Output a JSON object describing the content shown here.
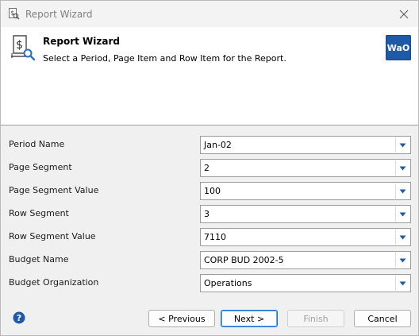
{
  "window": {
    "title": "Report Wizard"
  },
  "header": {
    "title": "Report Wizard",
    "subtitle": "Select a Period, Page Item and Row Item for the Report.",
    "logo_text": "WaO",
    "logo_color": "#1e5aa8"
  },
  "form": {
    "fields": [
      {
        "label": "Period Name",
        "value": "Jan-02"
      },
      {
        "label": "Page Segment",
        "value": "2"
      },
      {
        "label": "Page Segment Value",
        "value": "100"
      },
      {
        "label": "Row Segment",
        "value": "3"
      },
      {
        "label": "Row Segment Value",
        "value": "7110"
      },
      {
        "label": "Budget Name",
        "value": "CORP BUD 2002-5"
      },
      {
        "label": "Budget Organization",
        "value": "Operations"
      }
    ]
  },
  "footer": {
    "help_icon": "help-circle-icon",
    "previous_label": "< Previous",
    "next_label": "Next >",
    "finish_label": "Finish",
    "cancel_label": "Cancel"
  },
  "colors": {
    "accent": "#1c6fc9",
    "dropdown_arrow": "#1e5aa8",
    "help": "#1e5aa8"
  }
}
